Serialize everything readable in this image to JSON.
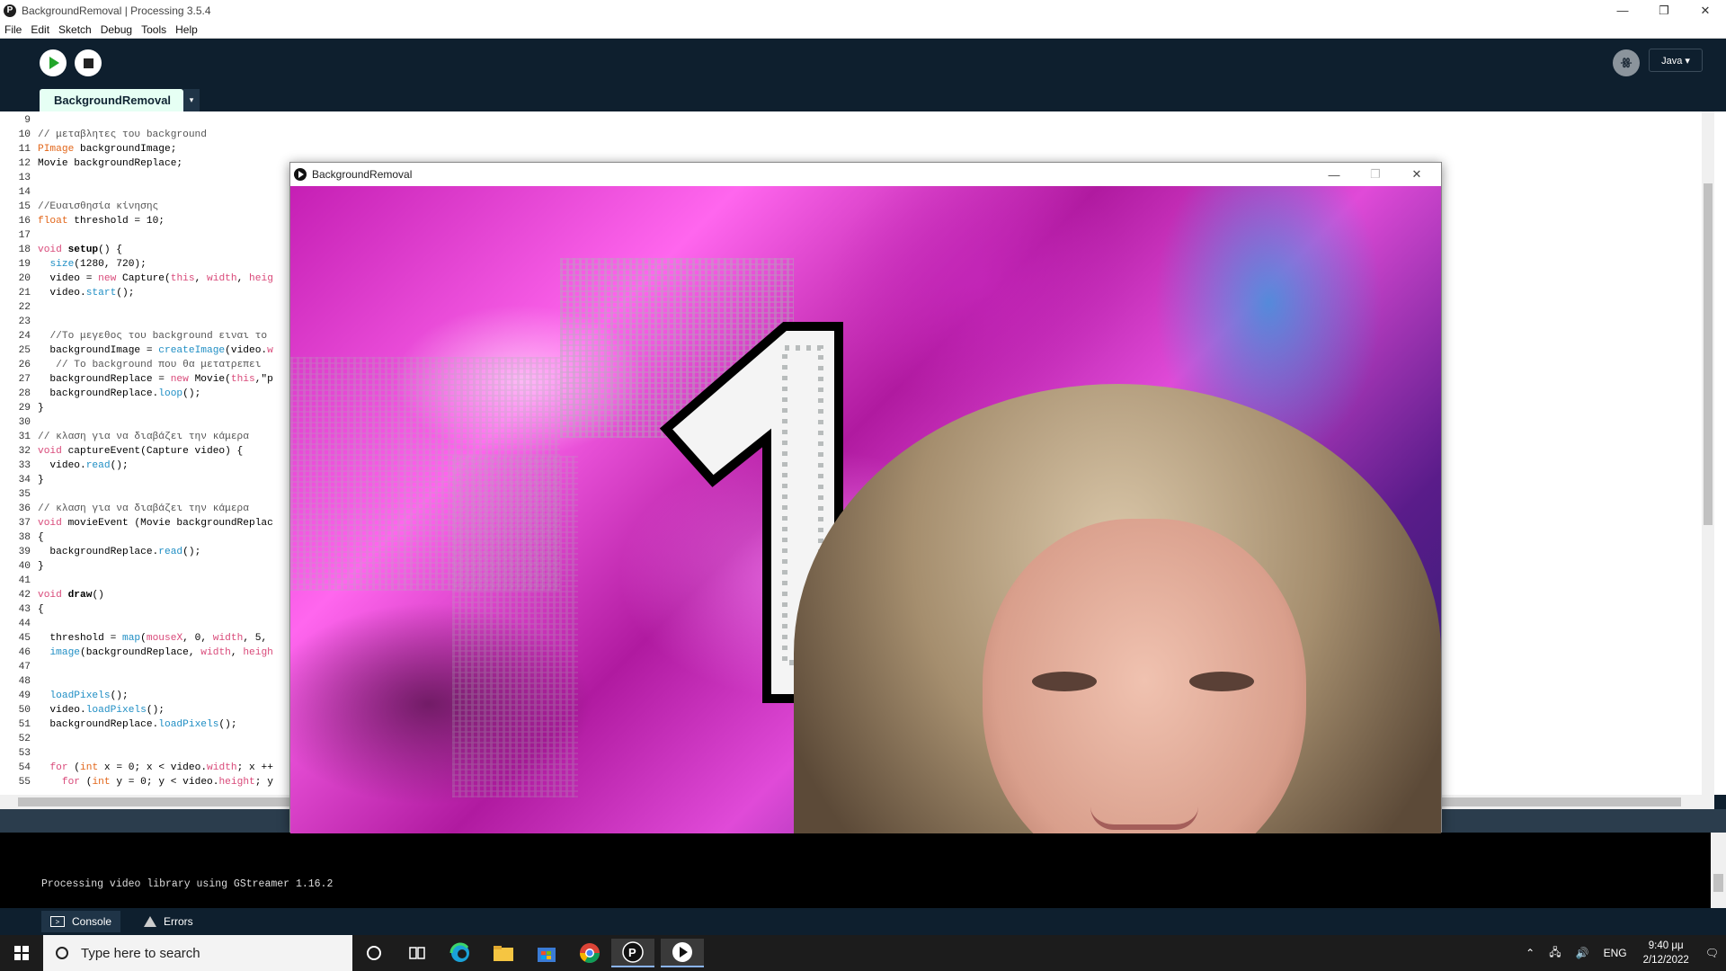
{
  "window": {
    "title": "BackgroundRemoval | Processing 3.5.4",
    "controls": [
      "—",
      "❐",
      "✕"
    ]
  },
  "menu": [
    "File",
    "Edit",
    "Sketch",
    "Debug",
    "Tools",
    "Help"
  ],
  "toolbar": {
    "mode_label": "Java ▾",
    "debug_label": "ꗥ"
  },
  "tab": {
    "label": "BackgroundRemoval",
    "menu_glyph": "▾"
  },
  "code_lines": [
    [
      "9",
      ""
    ],
    [
      "10",
      "<span class='cm'>// μεταβλητες του background</span>"
    ],
    [
      "11",
      "<span class='ty'>PImage</span> backgroundImage;"
    ],
    [
      "12",
      "Movie backgroundReplace;"
    ],
    [
      "13",
      ""
    ],
    [
      "14",
      ""
    ],
    [
      "15",
      "<span class='cm'>//Ευαισθησία κίνησης</span>"
    ],
    [
      "16",
      "<span class='ty'>float</span> threshold = 10;"
    ],
    [
      "17",
      ""
    ],
    [
      "18",
      "<span class='kw'>void</span> <b>setup</b>() {"
    ],
    [
      "19",
      "  <span class='fn'>size</span>(1280, 720);"
    ],
    [
      "20",
      "  video = <span class='kw'>new</span> Capture(<span class='kw'>this</span>, <span class='kw'>width</span>, <span class='kw'>heig</span>"
    ],
    [
      "21",
      "  video.<span class='fn'>start</span>();"
    ],
    [
      "22",
      ""
    ],
    [
      "23",
      ""
    ],
    [
      "24",
      "  <span class='cm'>//Το μεγεθος του background ειναι το</span>"
    ],
    [
      "25",
      "  backgroundImage = <span class='fn'>createImage</span>(video.<span class='kw'>w</span>"
    ],
    [
      "26",
      "   <span class='cm'>// Το background που θα μετατρεπει</span>"
    ],
    [
      "27",
      "  backgroundReplace = <span class='kw'>new</span> Movie(<span class='kw'>this</span>,\"p"
    ],
    [
      "28",
      "  backgroundReplace.<span class='fn'>loop</span>();"
    ],
    [
      "29",
      "}"
    ],
    [
      "30",
      ""
    ],
    [
      "31",
      "<span class='cm'>// κλαση για να διαβάζει την κάμερα</span>"
    ],
    [
      "32",
      "<span class='kw'>void</span> captureEvent(Capture video) {"
    ],
    [
      "33",
      "  video.<span class='fn'>read</span>();"
    ],
    [
      "34",
      "}"
    ],
    [
      "35",
      ""
    ],
    [
      "36",
      "<span class='cm'>// κλαση για να διαβάζει την κάμερα</span>"
    ],
    [
      "37",
      "<span class='kw'>void</span> movieEvent (Movie backgroundReplac"
    ],
    [
      "38",
      "{"
    ],
    [
      "39",
      "  backgroundReplace.<span class='fn'>read</span>();"
    ],
    [
      "40",
      "}"
    ],
    [
      "41",
      ""
    ],
    [
      "42",
      "<span class='kw'>void</span> <b>draw</b>()"
    ],
    [
      "43",
      "{"
    ],
    [
      "44",
      ""
    ],
    [
      "45",
      "  threshold = <span class='fn'>map</span>(<span class='kw'>mouseX</span>, 0, <span class='kw'>width</span>, 5,"
    ],
    [
      "46",
      "  <span class='fn'>image</span>(backgroundReplace, <span class='kw'>width</span>, <span class='kw'>heigh</span>"
    ],
    [
      "47",
      ""
    ],
    [
      "48",
      ""
    ],
    [
      "49",
      "  <span class='fn'>loadPixels</span>();"
    ],
    [
      "50",
      "  video.<span class='fn'>loadPixels</span>();"
    ],
    [
      "51",
      "  backgroundReplace.<span class='fn'>loadPixels</span>();"
    ],
    [
      "52",
      ""
    ],
    [
      "53",
      ""
    ],
    [
      "54",
      "  <span class='kw'>for</span> (<span class='ty'>int</span> x = 0; x &lt; video.<span class='kw'>width</span>; x ++"
    ],
    [
      "55",
      "    <span class='kw'>for</span> (<span class='ty'>int</span> y = 0; y &lt; video.<span class='kw'>height</span>; y"
    ]
  ],
  "console": {
    "message": "Processing video library using GStreamer 1.16.2"
  },
  "console_tabs": [
    "Console",
    "Errors"
  ],
  "sketch_window": {
    "title": "BackgroundRemoval",
    "countdown": "1"
  },
  "taskbar": {
    "search_placeholder": "Type here to search",
    "language": "ENG",
    "time": "9:40 μμ",
    "date": "2/12/2022"
  }
}
